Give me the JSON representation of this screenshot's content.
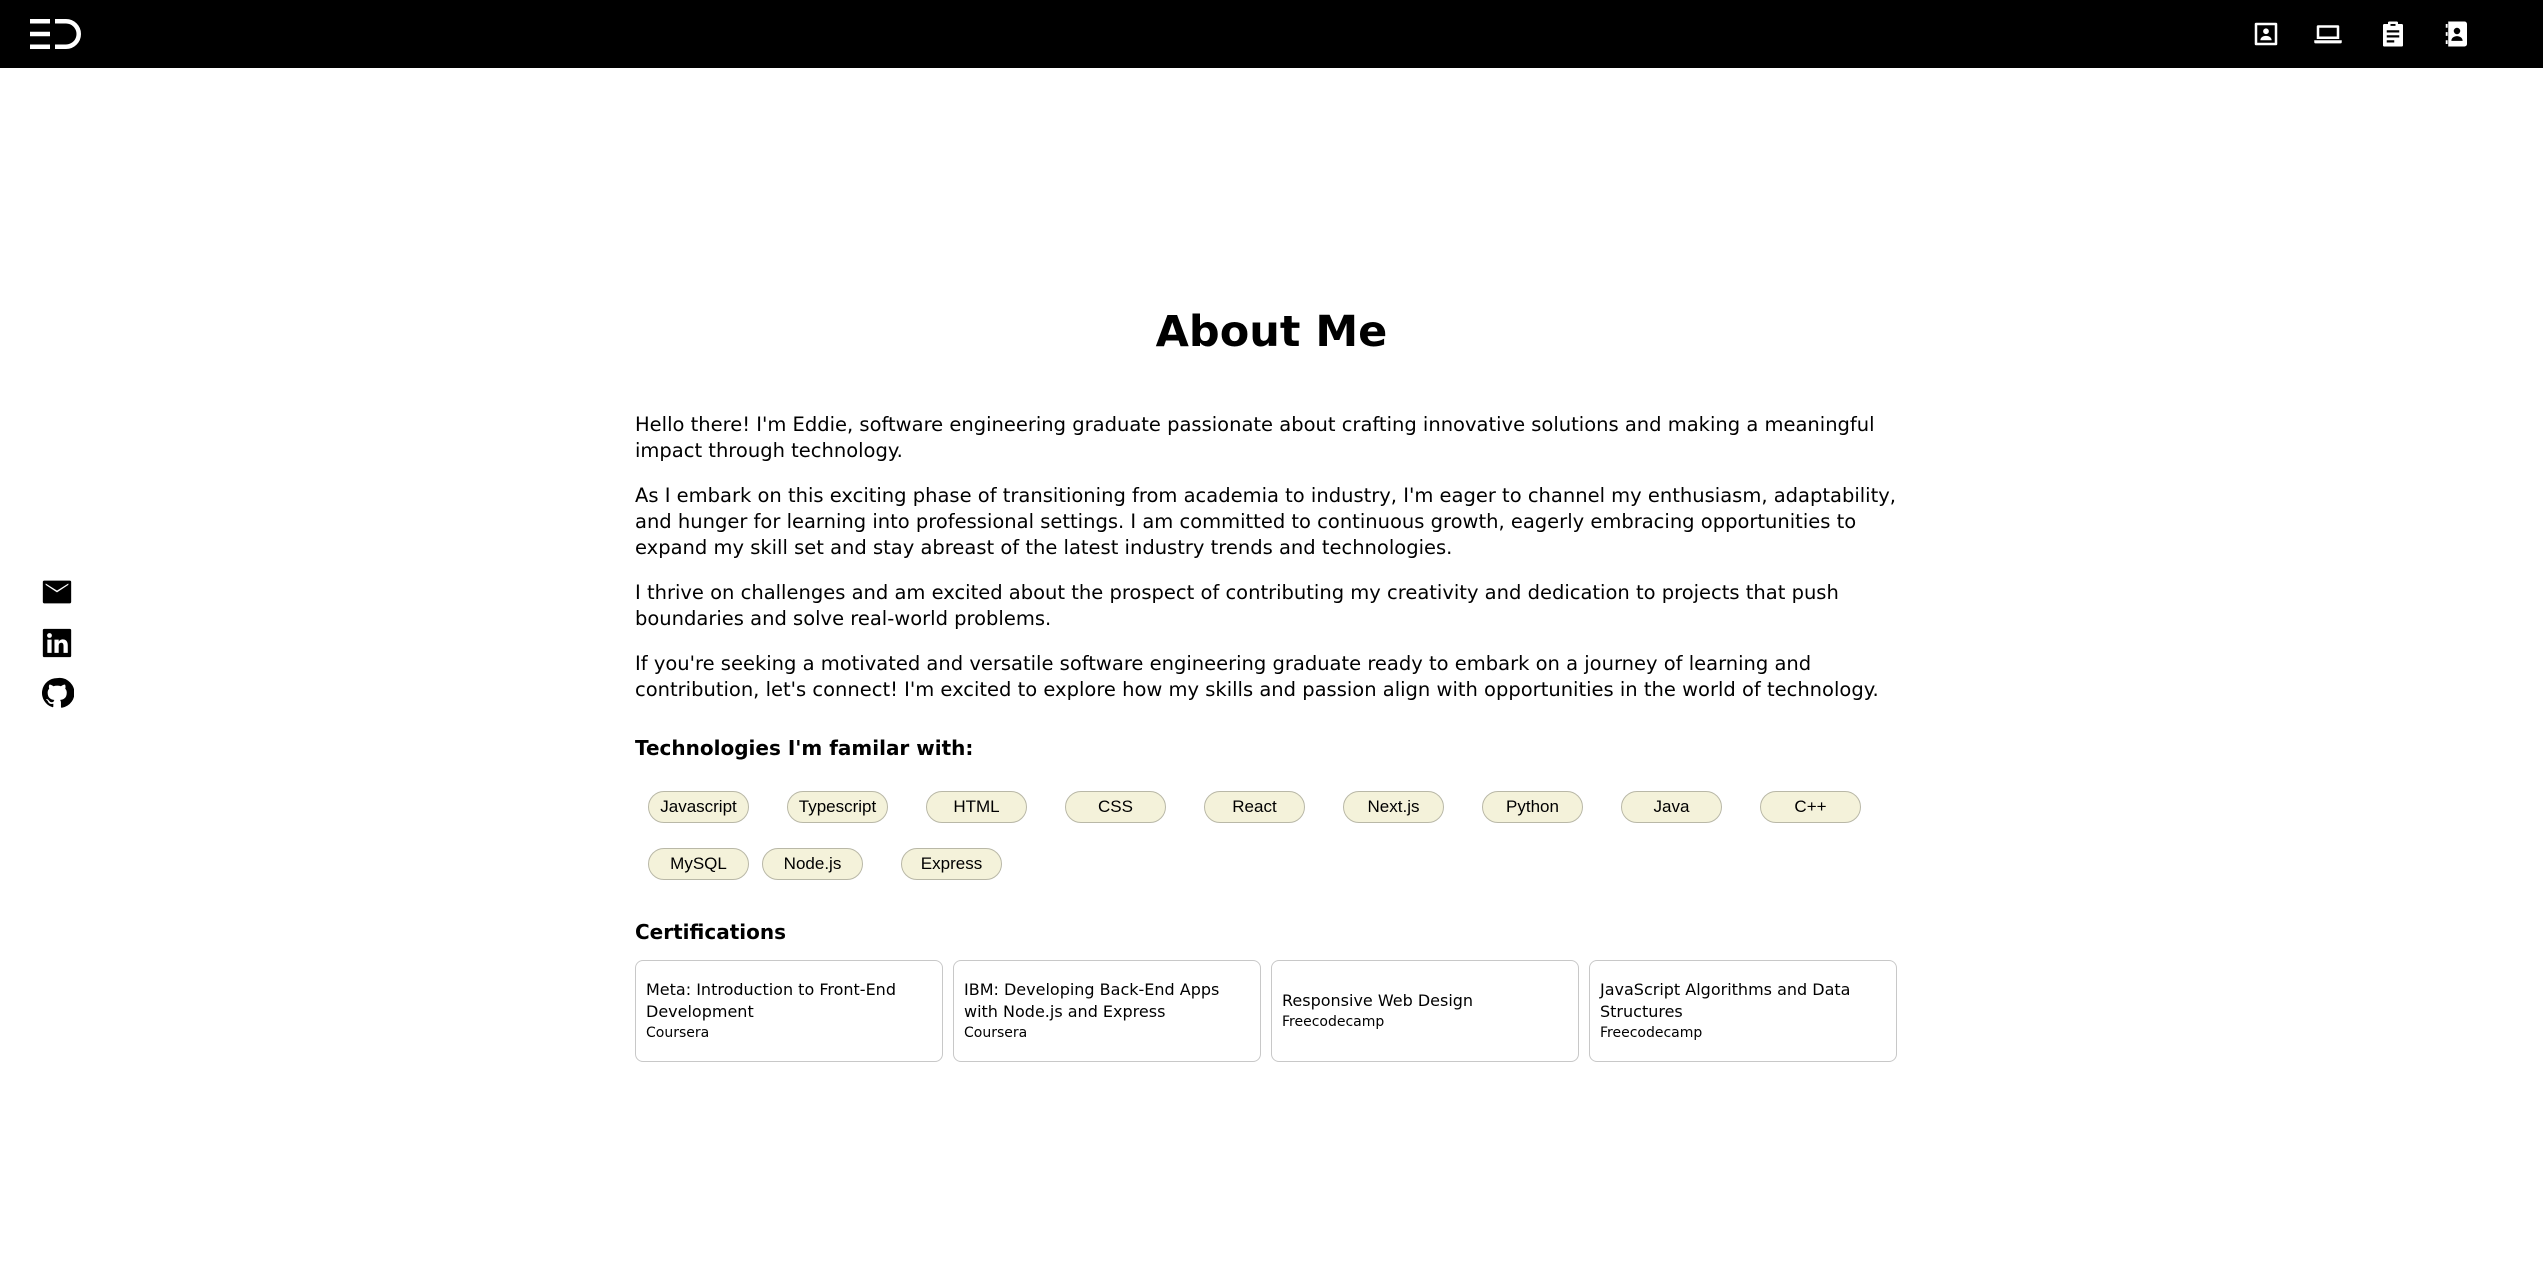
{
  "header": {
    "logo_text": "ED",
    "nav": [
      {
        "icon": "contact-card-icon"
      },
      {
        "icon": "laptop-icon"
      },
      {
        "icon": "clipboard-icon"
      },
      {
        "icon": "contact-book-icon"
      }
    ]
  },
  "social": [
    {
      "icon": "email-icon"
    },
    {
      "icon": "linkedin-icon"
    },
    {
      "icon": "github-icon"
    }
  ],
  "about": {
    "title": "About Me",
    "paragraphs": [
      "Hello there! I'm Eddie, software engineering graduate passionate about crafting innovative solutions and making a meaningful impact through technology.",
      "As I embark on this exciting phase of transitioning from academia to industry, I'm eager to channel my enthusiasm, adaptability, and hunger for learning into professional settings. I am committed to continuous growth, eagerly embracing opportunities to expand my skill set and stay abreast of the latest industry trends and technologies.",
      "I thrive on challenges and am excited about the prospect of contributing my creativity and dedication to projects that push boundaries and solve real-world problems.",
      "If you're seeking a motivated and versatile software engineering graduate ready to embark on a journey of learning and contribution, let's connect! I'm excited to explore how my skills and passion align with opportunities in the world of technology."
    ]
  },
  "technologies": {
    "heading": "Technologies I'm familar with:",
    "items": [
      "Javascript",
      "Typescript",
      "HTML",
      "CSS",
      "React",
      "Next.js",
      "Python",
      "Java",
      "C++",
      "MySQL",
      "Node.js",
      "Express"
    ]
  },
  "certifications": {
    "heading": "Certifications",
    "items": [
      {
        "title": "Meta: Introduction to Front-End Development",
        "issuer": "Coursera"
      },
      {
        "title": "IBM: Developing Back-End Apps with Node.js and Express",
        "issuer": "Coursera"
      },
      {
        "title": "Responsive Web Design",
        "issuer": "Freecodecamp"
      },
      {
        "title": "JavaScript Algorithms and Data Structures",
        "issuer": "Freecodecamp"
      }
    ]
  },
  "colors": {
    "header_bg": "#000000",
    "chip_bg": "#f4f2da",
    "chip_border": "#b9b8a7",
    "card_border": "#c8c8c8"
  }
}
